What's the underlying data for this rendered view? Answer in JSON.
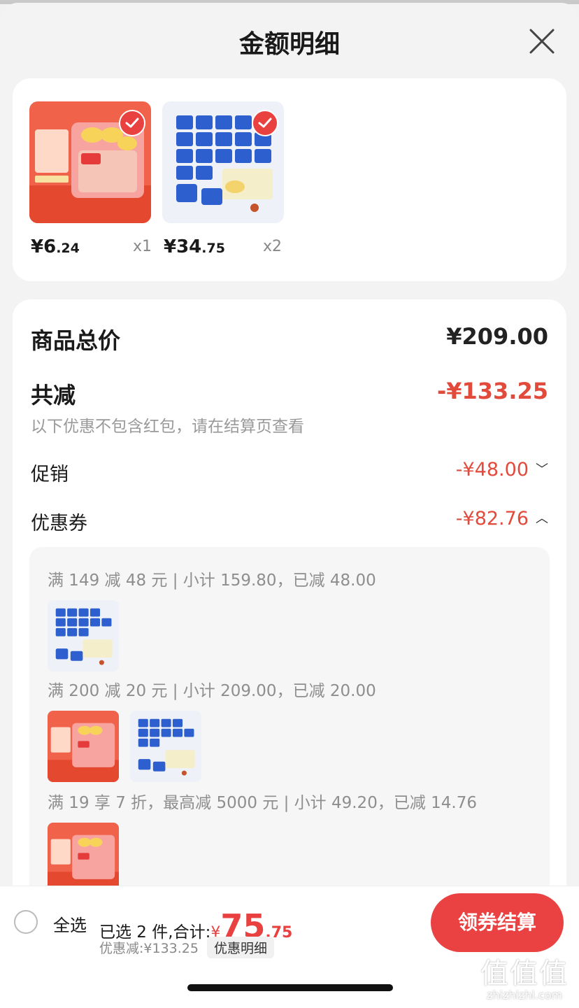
{
  "header": {
    "title": "金额明细"
  },
  "products": [
    {
      "price_int": "¥6",
      "price_dec": ".24",
      "qty": "x1",
      "image": "liby-laundry-pods",
      "selected": true
    },
    {
      "price_int": "¥34",
      "price_dec": ".75",
      "qty": "x2",
      "image": "tempo-tissue-pack",
      "selected": true
    }
  ],
  "breakdown": {
    "subtotal_label": "商品总价",
    "subtotal_value": "¥209.00",
    "total_discount_label": "共减",
    "total_discount_value": "-¥133.25",
    "note": "以下优惠不包含红包，请在结算页查看",
    "promo_label": "促销",
    "promo_value": "-¥48.00",
    "coupon_label": "优惠券",
    "coupon_value": "-¥82.76"
  },
  "coupon_rules": [
    {
      "text": "满 149 减 48 元 | 小计 159.80，已减 48.00"
    },
    {
      "text": "满 200 减 20 元 | 小计 209.00，已减 20.00"
    },
    {
      "text": "满 19 享 7 折，最高减 5000 元 | 小计 49.20，已减 14.76"
    }
  ],
  "bottom": {
    "select_all": "全选",
    "summary_prefix": "已选 2 件,合计:",
    "currency": "¥",
    "total_int": "75",
    "total_dec": ".75",
    "discount_text": "优惠减:¥133.25",
    "detail_label": "优惠明细",
    "checkout_label": "领券结算"
  },
  "watermark": {
    "main": "值值值",
    "sub": "zhizhizhi.com"
  },
  "colors": {
    "accent": "#e94040",
    "discount_red": "#e24a3b"
  }
}
